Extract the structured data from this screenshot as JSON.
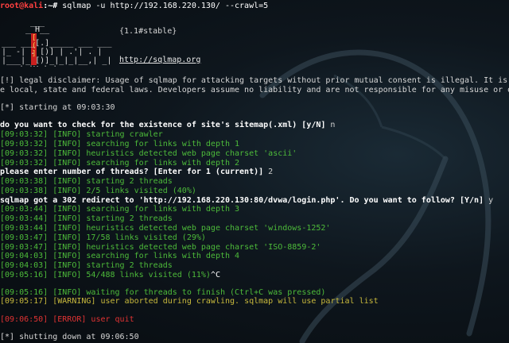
{
  "prompt": {
    "user": "root@kali",
    "sep": ":~#",
    "command": " sqlmap -u http://192.168.220.130/ --crawl=5"
  },
  "banner": {
    "version": "{1.1#stable}",
    "url": "http://sqlmap.org"
  },
  "disclaimer": {
    "line1": "[!] legal disclaimer: Usage of sqlmap for attacking targets without prior mutual consent is illegal. It is the",
    "line2": "e local, state and federal laws. Developers assume no liability and are not responsible for any misuse or damag"
  },
  "starting": "[*] starting at 09:03:30",
  "lines": [
    {
      "text": "do you want to check for the existence of site's sitemap(.xml) [y/N] ",
      "answer": "n"
    },
    {
      "time": "[09:03:32]",
      "level": "[INFO]",
      "msg": " starting crawler"
    },
    {
      "time": "[09:03:32]",
      "level": "[INFO]",
      "msg": " searching for links with depth 1"
    },
    {
      "time": "[09:03:32]",
      "level": "[INFO]",
      "msg": " heuristics detected web page charset 'ascii'"
    },
    {
      "time": "[09:03:32]",
      "level": "[INFO]",
      "msg": " searching for links with depth 2"
    },
    {
      "text": "please enter number of threads? [Enter for 1 (current)] ",
      "answer": "2"
    },
    {
      "time": "[09:03:38]",
      "level": "[INFO]",
      "msg": " starting 2 threads"
    },
    {
      "time": "[09:03:38]",
      "level": "[INFO]",
      "msg": " 2/5 links visited (40%)"
    },
    {
      "text": "sqlmap got a 302 redirect to 'http://192.168.220.130:80/dvwa/login.php'. Do you want to follow? [Y/n] ",
      "answer": "y"
    },
    {
      "time": "[09:03:44]",
      "level": "[INFO]",
      "msg": " searching for links with depth 3"
    },
    {
      "time": "[09:03:44]",
      "level": "[INFO]",
      "msg": " starting 2 threads"
    },
    {
      "time": "[09:03:44]",
      "level": "[INFO]",
      "msg": " heuristics detected web page charset 'windows-1252'"
    },
    {
      "time": "[09:03:47]",
      "level": "[INFO]",
      "msg": " 17/58 links visited (29%)"
    },
    {
      "time": "[09:03:47]",
      "level": "[INFO]",
      "msg": " heuristics detected web page charset 'ISO-8859-2'"
    },
    {
      "time": "[09:04:03]",
      "level": "[INFO]",
      "msg": " searching for links with depth 4"
    },
    {
      "time": "[09:04:03]",
      "level": "[INFO]",
      "msg": " starting 2 threads"
    },
    {
      "time": "[09:05:16]",
      "level": "[INFO]",
      "msg": " 54/488 links visited (11%)",
      "tail": "^C"
    },
    {
      "time": "[09:05:16]",
      "level": "[INFO]",
      "msg": " waiting for threads to finish (Ctrl+C was pressed)"
    },
    {
      "time": "[09:05:17]",
      "level": "[WARNING]",
      "msg": " user aborted during crawling. sqlmap will use partial list"
    },
    {
      "time": "[09:06:50]",
      "level": "[ERROR]",
      "msg": " user quit"
    }
  ],
  "shutdown": "[*] shutting down at 09:06:50",
  "colors": {
    "root": "#ff4040",
    "info": "#4dbb3a",
    "warning": "#c8b93c",
    "error": "#e03333",
    "background": "#0b1015"
  }
}
